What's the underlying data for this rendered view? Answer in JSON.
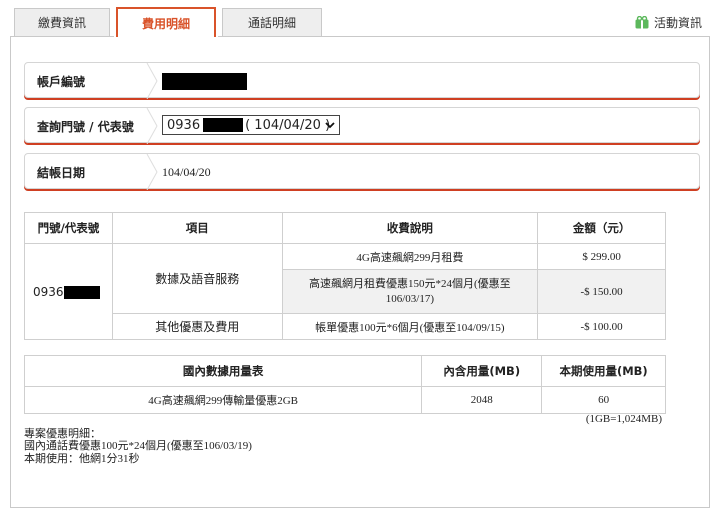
{
  "tabs": [
    "繳費資訊",
    "費用明細",
    "通話明細"
  ],
  "active_tab": "費用明細",
  "activity_link": "活動資訊",
  "account": {
    "label": "帳戶編號",
    "number_label": "查詢門號 / 代表號",
    "select_prefix": "0936",
    "select_suffix": "( 104/04/20 )",
    "date_label": "結帳日期",
    "date_value": "104/04/20"
  },
  "fee_table": {
    "headers": [
      "門號/代表號",
      "項目",
      "收費說明",
      "金額（元）"
    ],
    "phone_prefix": "0936",
    "item1": "數據及語音服務",
    "item2": "其他優惠及費用",
    "desc1": "4G高速飆網299月租費",
    "desc2": "高速飆網月租費優惠150元*24個月(優惠至106/03/17)",
    "desc3": "帳單優惠100元*6個月(優惠至104/09/15)",
    "amt1": "$ 299.00",
    "amt2": "-$ 150.00",
    "amt3": "-$ 100.00"
  },
  "data_table": {
    "headers": [
      "國內數據用量表",
      "內含用量(MB)",
      "本期使用量(MB)"
    ],
    "row": [
      "4G高速飆網299傳輸量優惠2GB",
      "2048",
      "60"
    ],
    "note": "(1GB=1,024MB)"
  },
  "notes": {
    "title": "專案優惠明細：",
    "line1": "國內通話費優惠100元*24個月(優惠至106/03/19)",
    "line2": "本期使用：他網1分31秒"
  },
  "colors": {
    "accent": "#d9532a",
    "gift_icon": "#5cb85c"
  }
}
